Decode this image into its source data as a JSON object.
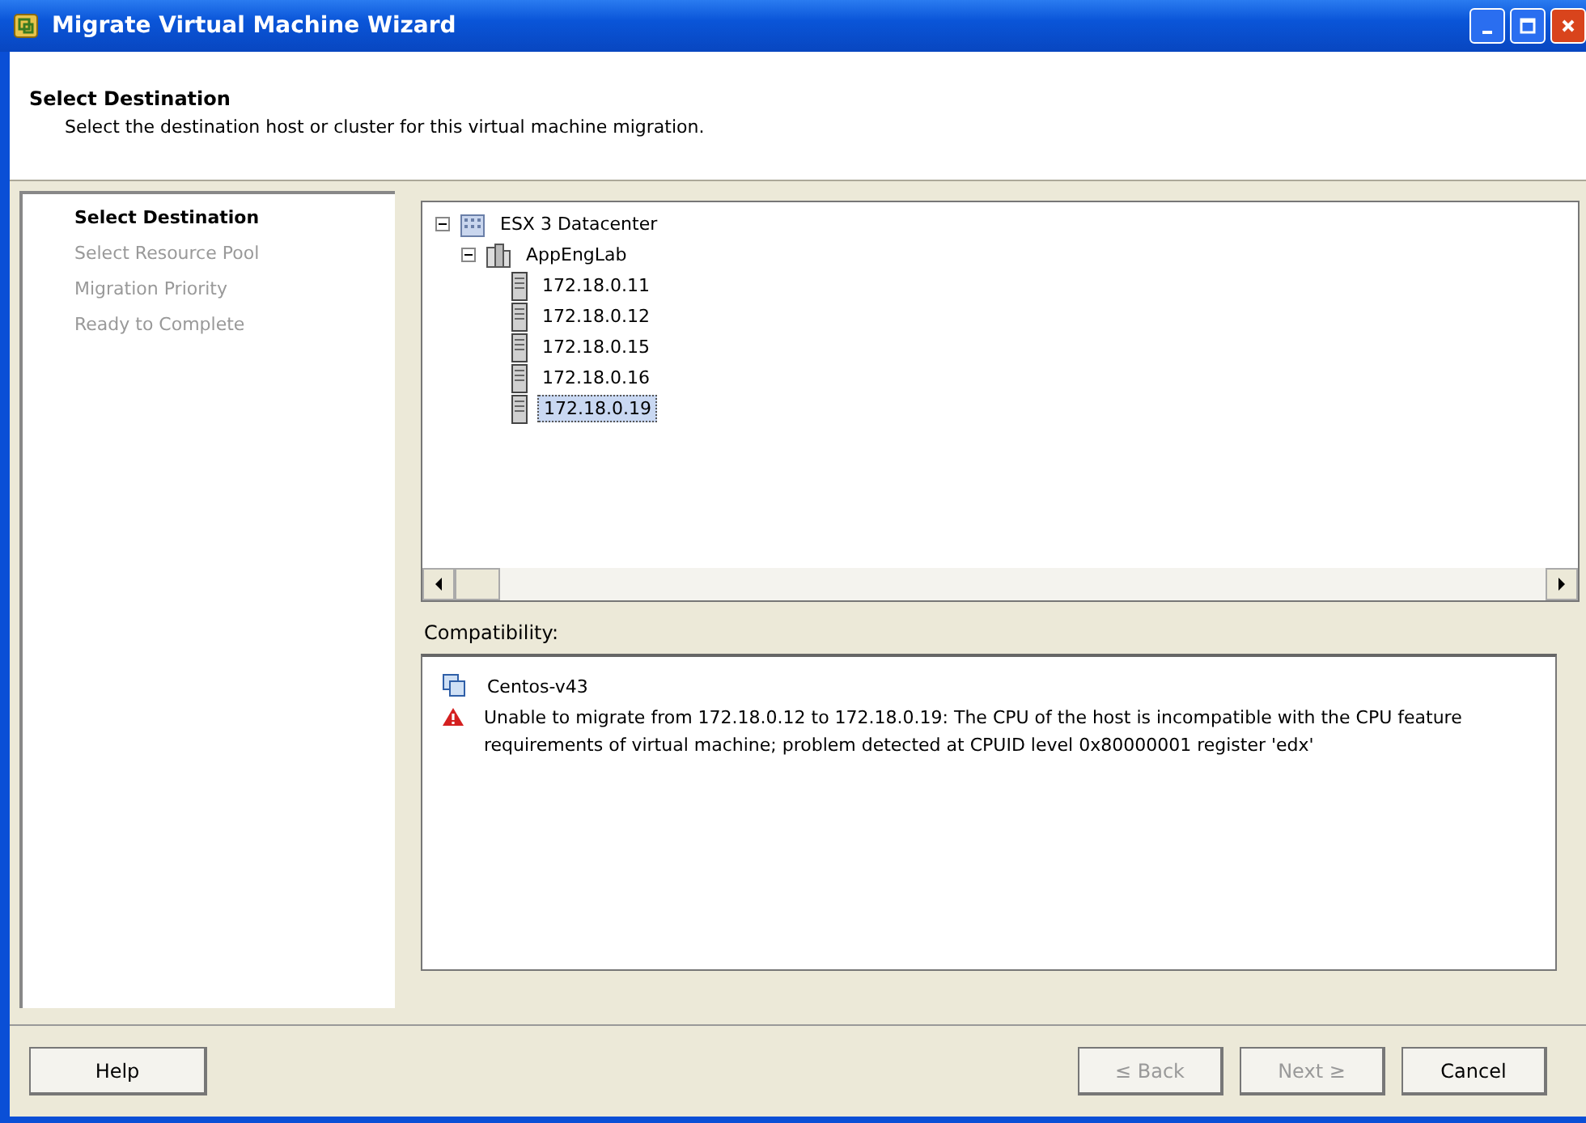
{
  "window": {
    "title": "Migrate Virtual Machine Wizard"
  },
  "header": {
    "title": "Select Destination",
    "subtitle": "Select the destination host or cluster for this virtual machine migration."
  },
  "steps": [
    {
      "label": "Select Destination",
      "selected": true
    },
    {
      "label": "Select Resource Pool",
      "selected": false
    },
    {
      "label": "Migration Priority",
      "selected": false
    },
    {
      "label": "Ready to Complete",
      "selected": false
    }
  ],
  "tree": [
    {
      "label": "ESX 3 Datacenter",
      "kind": "datacenter",
      "expanded": true,
      "selected": false,
      "children": [
        {
          "label": "AppEngLab",
          "kind": "cluster",
          "expanded": true,
          "selected": false,
          "children": [
            {
              "label": "172.18.0.11",
              "kind": "host",
              "selected": false
            },
            {
              "label": "172.18.0.12",
              "kind": "host",
              "selected": false
            },
            {
              "label": "172.18.0.15",
              "kind": "host",
              "selected": false
            },
            {
              "label": "172.18.0.16",
              "kind": "host",
              "selected": false
            },
            {
              "label": "172.18.0.19",
              "kind": "host",
              "selected": true
            }
          ]
        }
      ]
    }
  ],
  "compatibility": {
    "label": "Compatibility:",
    "vm": "Centos-v43",
    "message": "Unable to migrate from 172.18.0.12 to 172.18.0.19: The CPU of the host is incompatible with the CPU feature requirements of virtual machine; problem detected at CPUID level 0x80000001 register 'edx'"
  },
  "buttons": [
    {
      "label": "Help",
      "disabled": false
    },
    {
      "label": "≤ Back",
      "disabled": true
    },
    {
      "label": "Next ≥",
      "disabled": true
    },
    {
      "label": "Cancel",
      "disabled": false
    }
  ]
}
